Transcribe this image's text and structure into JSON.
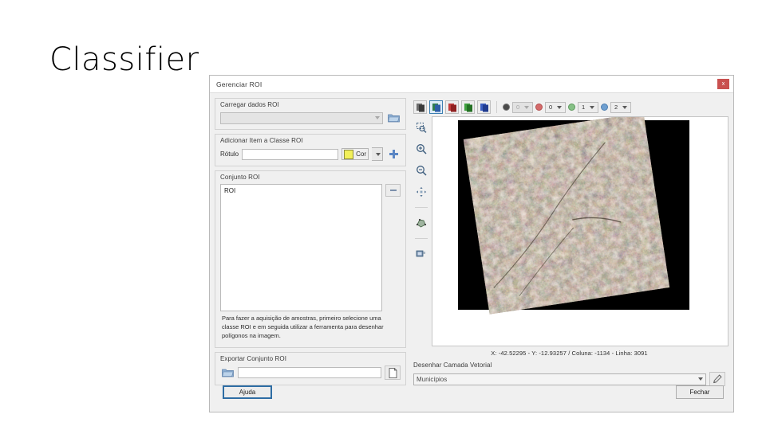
{
  "slide": {
    "title": "Classifier"
  },
  "dialog": {
    "title": "Gerenciar ROI",
    "close_label": "x",
    "load_group": {
      "title": "Carregar dados ROI",
      "combo_value": "",
      "browse_icon": "folder-icon"
    },
    "add_class_group": {
      "title": "Adicionar Item a Classe ROI",
      "label": "Rótulo",
      "input_value": "",
      "color_label": "Cor",
      "color_hex": "#f2f05a",
      "add_icon": "plus-icon"
    },
    "roi_set_group": {
      "title": "Conjunto ROI",
      "items": [
        "ROI"
      ],
      "remove_icon": "minus-icon"
    },
    "help_text": "Para fazer a aquisição de amostras, primeiro selecione uma classe ROI e em seguida utilizar a ferramenta para desenhar polígonos na imagem.",
    "export_group": {
      "title": "Exportar Conjunto ROI",
      "folder_icon": "folder-icon",
      "path_value": "",
      "save_icon": "save-file-icon"
    },
    "footer": {
      "help_button": "Ajuda",
      "close_button": "Fechar"
    }
  },
  "map_panel": {
    "band_buttons": [
      {
        "name": "band-gray",
        "active": false
      },
      {
        "name": "band-rgb-composite",
        "active": true
      },
      {
        "name": "band-red",
        "active": false
      },
      {
        "name": "band-green",
        "active": false
      },
      {
        "name": "band-blue",
        "active": false
      }
    ],
    "channel_controls": [
      {
        "dot": "mono",
        "value": "0",
        "disabled": true
      },
      {
        "dot": "red",
        "value": "0",
        "disabled": false
      },
      {
        "dot": "green",
        "value": "1",
        "disabled": false
      },
      {
        "dot": "blue",
        "value": "2",
        "disabled": false
      }
    ],
    "tools": [
      "zoom-to-selection-icon",
      "zoom-in-icon",
      "zoom-out-icon",
      "pan-icon",
      "draw-polygon-icon",
      "layer-info-icon"
    ],
    "status_text": "X: -42.52295 - Y: -12.93257 / Coluna: -1134 - Linha: 3091",
    "vector_group": {
      "title": "Desenhar Camada Vetorial",
      "selected": "Municípios",
      "edit_icon": "pencil-icon"
    }
  }
}
